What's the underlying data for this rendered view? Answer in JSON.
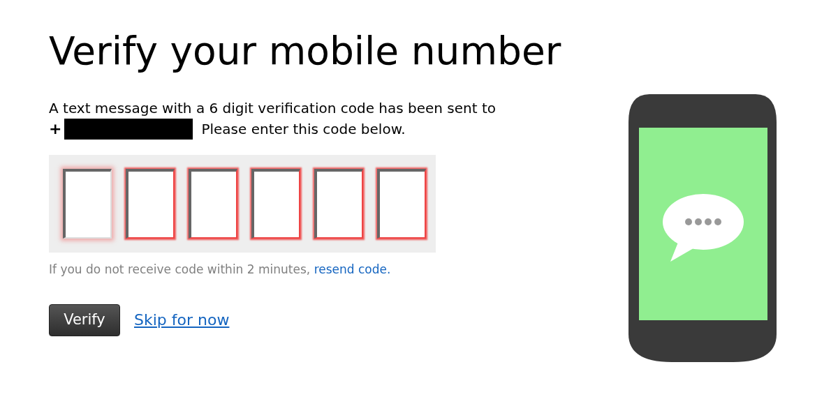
{
  "title": "Verify your mobile number",
  "message": {
    "line_1": "A text message with a 6 digit verification code has been sent to",
    "prefix": "+",
    "line_2": "Please enter this code below."
  },
  "code_boxes": [
    {
      "focused": true
    },
    {
      "focused": false
    },
    {
      "focused": false
    },
    {
      "focused": false
    },
    {
      "focused": false
    },
    {
      "focused": false
    }
  ],
  "hint": {
    "text": "If you do not receive code within 2 minutes,",
    "link": "resend code."
  },
  "verify_button": "Verify",
  "skip_link": "Skip for now"
}
